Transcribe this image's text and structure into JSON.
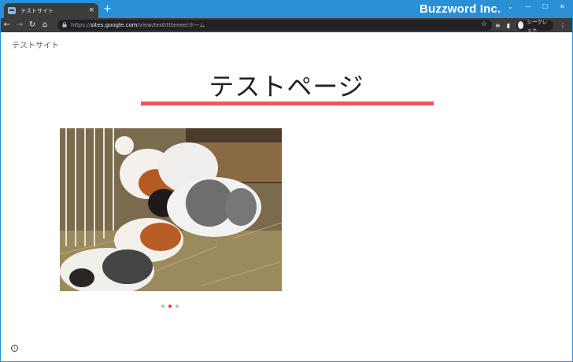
{
  "browser": {
    "tab": {
      "title": "テストサイト",
      "close": "×"
    },
    "new_tab": "+",
    "brand": "Buzzword Inc.",
    "window_controls": {
      "minimize": "—",
      "maximize": "☐",
      "close": "✕",
      "dropdown": "⌄"
    },
    "nav": {
      "back": "←",
      "forward": "→",
      "reload": "↻",
      "home": "⌂"
    },
    "url_prefix": "https://",
    "url_host": "sites.google.com",
    "url_path": "/view/testtttteeee/ホーム",
    "incognito_label": "シークレット"
  },
  "page": {
    "site_name": "テストサイト",
    "title": "テストページ",
    "accent_color": "#f55454",
    "carousel": {
      "slides": 3,
      "active_index": 1
    }
  },
  "icons": {
    "lock": "lock-icon",
    "star": "star-icon",
    "info": "info-icon"
  }
}
